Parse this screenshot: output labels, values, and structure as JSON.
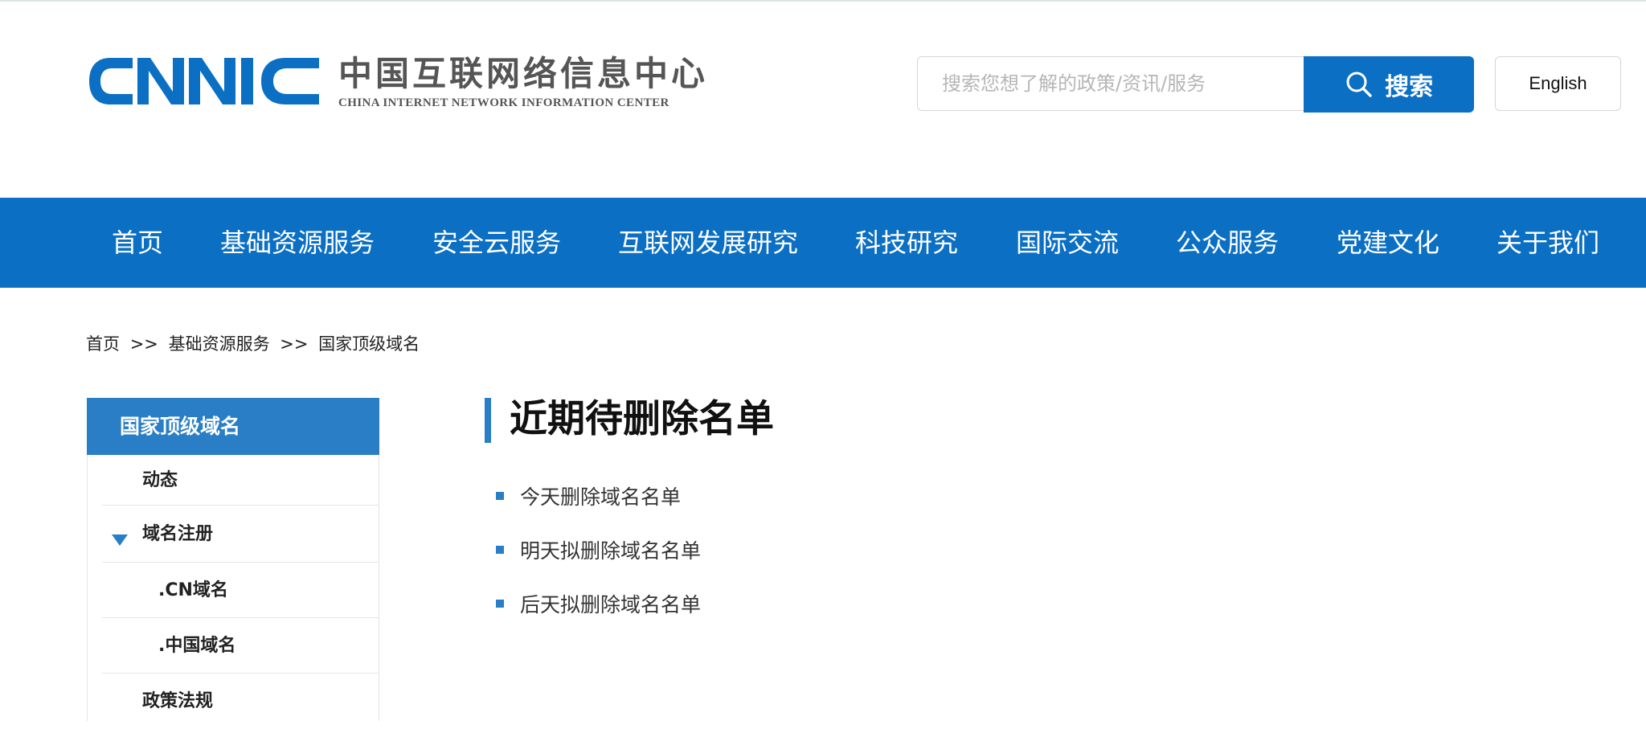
{
  "header": {
    "logo_mark": "CNNIC",
    "logo_cn": "中国互联网络信息中心",
    "logo_en": "CHINA INTERNET NETWORK INFORMATION CENTER",
    "search_placeholder": "搜索您想了解的政策/资讯/服务",
    "search_button": "搜索",
    "language_button": "English",
    "colors": {
      "brand_blue": "#0b6fc4",
      "logo_gray": "#555555"
    }
  },
  "nav": {
    "items": [
      "首页",
      "基础资源服务",
      "安全云服务",
      "互联网发展研究",
      "科技研究",
      "国际交流",
      "公众服务",
      "党建文化",
      "关于我们"
    ]
  },
  "breadcrumb": {
    "items": [
      "首页",
      ">>",
      "基础资源服务",
      ">>",
      "国家顶级域名"
    ]
  },
  "sidebar": {
    "heading": "国家顶级域名",
    "items": [
      "动态",
      "域名注册",
      ".CN域名",
      ".中国域名",
      "政策法规"
    ],
    "expanded_icon": "triangle-down-icon"
  },
  "main": {
    "title": "近期待删除名单",
    "links": [
      "今天删除域名名单",
      "明天拟删除域名名单",
      "后天拟删除域名名单"
    ]
  }
}
